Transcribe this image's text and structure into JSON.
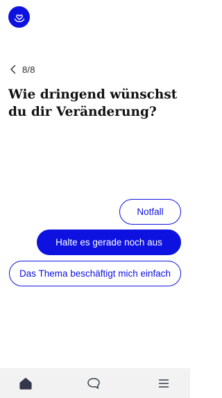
{
  "header": {
    "logo_icon": "heart-smile-logo-icon",
    "brand_color": "#0e12e0"
  },
  "progress": {
    "back_icon": "chevron-left-icon",
    "counter": "8/8"
  },
  "question": {
    "text": "Wie dringend wünschst du dir Veränderung?"
  },
  "answers": [
    {
      "label": "Notfall",
      "selected": false
    },
    {
      "label": "Halte es gerade noch aus",
      "selected": true
    },
    {
      "label": "Das Thema beschäftigt mich einfach",
      "selected": false
    }
  ],
  "bottom_nav": {
    "items": [
      {
        "icon": "home-icon",
        "active": true
      },
      {
        "icon": "chat-bubble-icon",
        "active": false
      },
      {
        "icon": "menu-icon",
        "active": false
      }
    ]
  }
}
